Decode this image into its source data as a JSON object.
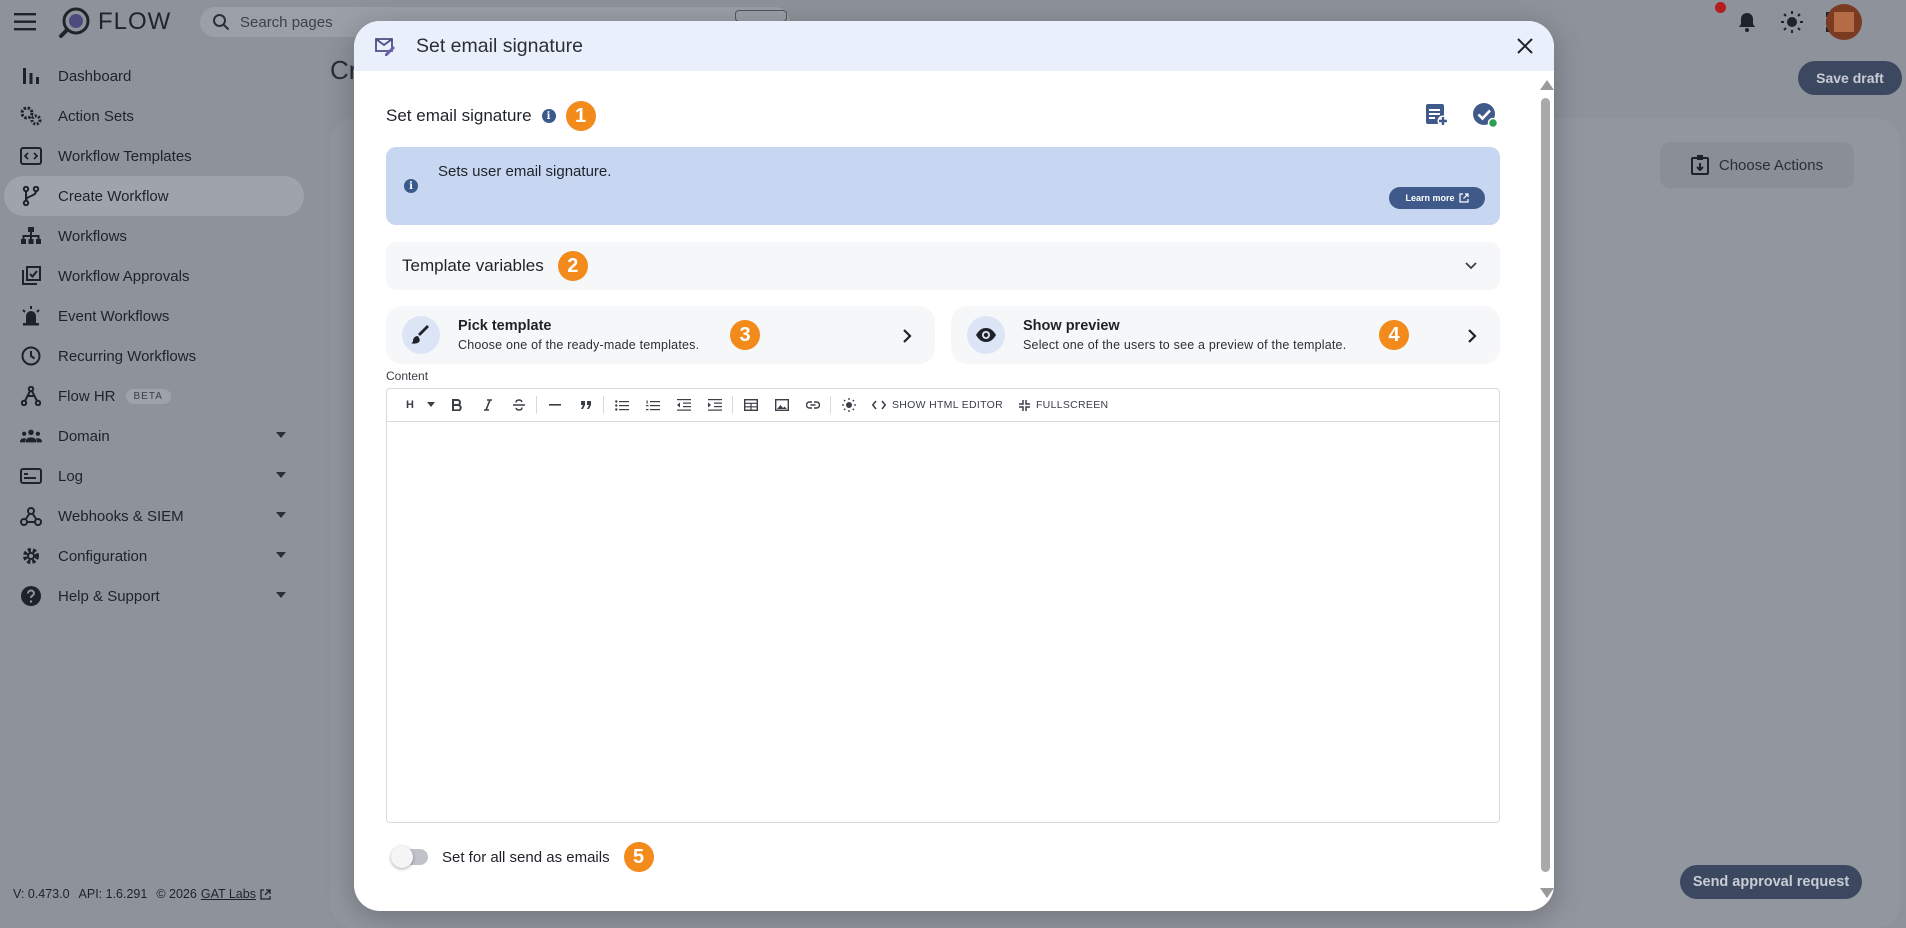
{
  "app": {
    "name": "FLOW",
    "search_placeholder": "Search pages",
    "page_title": "Cr",
    "save_draft": "Save draft",
    "choose_actions": "Choose Actions",
    "send_approval": "Send approval request"
  },
  "sidebar": {
    "items": [
      {
        "label": "Dashboard",
        "icon": "bar-chart-icon"
      },
      {
        "label": "Action Sets",
        "icon": "gears-icon"
      },
      {
        "label": "Workflow Templates",
        "icon": "template-icon"
      },
      {
        "label": "Create Workflow",
        "icon": "branch-icon",
        "active": true
      },
      {
        "label": "Workflows",
        "icon": "hierarchy-icon"
      },
      {
        "label": "Workflow Approvals",
        "icon": "approval-icon"
      },
      {
        "label": "Event Workflows",
        "icon": "alarm-icon"
      },
      {
        "label": "Recurring Workflows",
        "icon": "clock-icon"
      },
      {
        "label": "Flow HR",
        "icon": "hr-icon",
        "badge": "BETA"
      },
      {
        "label": "Domain",
        "icon": "group-icon"
      },
      {
        "label": "Log",
        "icon": "log-icon"
      },
      {
        "label": "Webhooks & SIEM",
        "icon": "webhook-icon"
      },
      {
        "label": "Configuration",
        "icon": "gear-icon"
      },
      {
        "label": "Help & Support",
        "icon": "help-icon"
      }
    ]
  },
  "footer": {
    "version": "V: 0.473.0",
    "api": "API: 1.6.291",
    "copyright": "© 2026",
    "company": "GAT Labs"
  },
  "modal": {
    "title": "Set email signature",
    "section_title": "Set email signature",
    "info_text": "Sets user email signature.",
    "learn_more": "Learn more",
    "template_variables": "Template variables",
    "pick_template": {
      "title": "Pick template",
      "subtitle": "Choose one of the ready-made templates."
    },
    "show_preview": {
      "title": "Show preview",
      "subtitle": "Select one of the users to see a preview of the template."
    },
    "content_label": "Content",
    "toolbar": {
      "heading": "H",
      "show_html": "SHOW HTML EDITOR",
      "fullscreen": "FULLSCREEN"
    },
    "toggle_label": "Set for all send as emails",
    "steps": [
      "1",
      "2",
      "3",
      "4",
      "5"
    ]
  },
  "colors": {
    "accent": "#f28a1c",
    "primary": "#3f5a8a",
    "info_bg": "#c7d7f1",
    "header_bg": "#eaf0fb"
  }
}
